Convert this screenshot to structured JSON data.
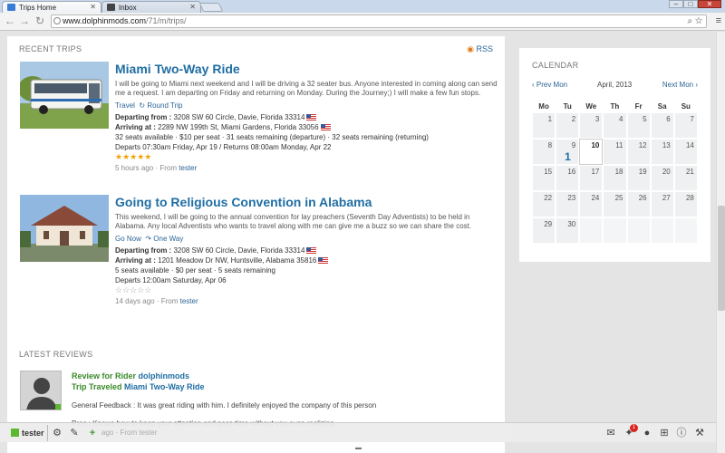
{
  "browser": {
    "tabs": [
      {
        "label": "Trips Home",
        "active": true
      },
      {
        "label": "Inbox",
        "active": false
      }
    ],
    "url_host": "www.dolphinmods.com",
    "url_path": "/71/m/trips/",
    "window_buttons": {
      "minimize": "–",
      "maximize": "□",
      "close": "✕"
    }
  },
  "recent_trips": {
    "heading": "RECENT TRIPS",
    "rss_label": "RSS",
    "trips": [
      {
        "title": "Miami Two-Way Ride",
        "description": "I will be going to Miami next weekend and I will be driving a 32 seater bus. Anyone interested in coming along can send me a request. I am departing on Friday and returning on Monday. During the Journey;) I will make a few fun stops.",
        "category": "Travel",
        "trip_type": "Round Trip",
        "departing_label": "Departing from :",
        "departing": "3208 SW 60 Circle, Davie, Florida 33314",
        "arriving_label": "Arriving at :",
        "arriving": "2289 NW 199th St, Miami Gardens, Florida 33056",
        "seats_available": "32 seats available",
        "price": "$10 per seat",
        "remaining_dep": "31 seats remaining (departure)",
        "remaining_ret": "32 seats remaining (returning)",
        "schedule": "Departs 07:30am Friday, Apr 19 / Returns 08:00am Monday, Apr 22",
        "rating": "★★★★★",
        "posted": "5 hours ago",
        "from_label": "From",
        "author": "tester"
      },
      {
        "title": "Going to Religious Convention in Alabama",
        "description": "This weekend, I will be going to the annual convention for lay preachers (Seventh Day Adventists) to be held in Alabama. Any local Adventists who wants to travel along with me can give me a buzz so we can share the cost.",
        "category": "Go Now",
        "trip_type": "One Way",
        "departing_label": "Departing from :",
        "departing": "3208 SW 60 Circle, Davie, Florida 33314",
        "arriving_label": "Arriving at :",
        "arriving": "1201 Meadow Dr NW, Huntsville, Alabama 35816",
        "seats_available": "5 seats available",
        "price": "$0 per seat",
        "remaining": "5 seats remaining",
        "schedule": "Departs 12:00am Saturday, Apr 06",
        "rating": "☆☆☆☆☆",
        "posted": "14 days ago",
        "from_label": "From",
        "author": "tester"
      }
    ]
  },
  "latest_reviews": {
    "heading": "LATEST REVIEWS",
    "review": {
      "line1_prefix": "Review for Rider",
      "line1_user": "dolphinmods",
      "line2_prefix": "Trip Traveled",
      "line2_trip": "Miami Two-Way Ride",
      "general": "General Feedback : It was great riding with him. I definitely enjoyed the company of this person",
      "pros": "Pros : Knows how to keep your attention and pass time without you even realizing."
    }
  },
  "calendar": {
    "heading": "CALENDAR",
    "prev": "‹ Prev Mon",
    "month": "April, 2013",
    "next": "Next Mon ›",
    "weekdays": [
      "Mo",
      "Tu",
      "We",
      "Th",
      "Fr",
      "Sa",
      "Su"
    ],
    "weeks": [
      [
        "1",
        "2",
        "3",
        "4",
        "5",
        "6",
        "7"
      ],
      [
        "8",
        "9",
        "10",
        "11",
        "12",
        "13",
        "14"
      ],
      [
        "15",
        "16",
        "17",
        "18",
        "19",
        "20",
        "21"
      ],
      [
        "22",
        "23",
        "24",
        "25",
        "26",
        "27",
        "28"
      ],
      [
        "29",
        "30",
        "",
        "",
        "",
        "",
        ""
      ]
    ],
    "today": "10",
    "event_day": "9",
    "event_count": "1"
  },
  "toolbar": {
    "user": "tester",
    "notification_count": "1",
    "hidden_text": "ago · From tester"
  },
  "colors": {
    "link": "#1f6ea3",
    "review_green": "#3a8a2a",
    "star": "#f0a30a",
    "badge": "#d9251d"
  }
}
